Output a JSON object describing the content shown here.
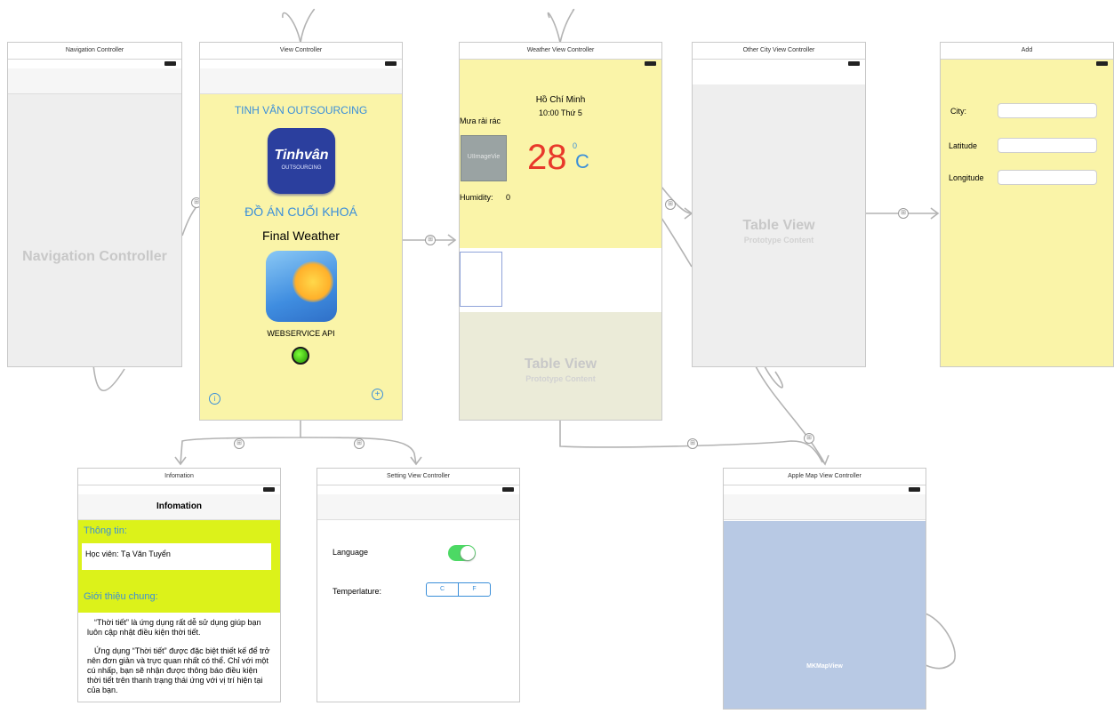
{
  "scenes": {
    "navigation": {
      "title": "Navigation Controller",
      "label": "Navigation Controller"
    },
    "view": {
      "title": "View Controller",
      "heading": "TINH VÂN OUTSOURCING",
      "logo_text": "Tinhvân",
      "logo_sub": "OUTSOURCING",
      "project": "ĐỒ ÁN CUỐI KHOÁ",
      "app_name": "Final Weather",
      "api": "WEBSERVICE API",
      "info_icon": "info-icon",
      "add_icon": "plus-circle-icon"
    },
    "weather": {
      "title": "Weather View Controller",
      "city": "Hồ Chí Minh",
      "time": "10:00 Thứ 5",
      "condition": "Mưa rải rác",
      "image_placeholder": "UIImageVie",
      "temperature": "28",
      "degree": "0",
      "unit": "C",
      "humidity_label": "Humidity:",
      "humidity_value": "0",
      "table_title": "Table View",
      "table_sub": "Prototype Content"
    },
    "other_city": {
      "title": "Other City View Controller",
      "table_title": "Table View",
      "table_sub": "Prototype Content"
    },
    "add": {
      "title": "Add",
      "city_label": "City:",
      "lat_label": "Latitude",
      "lon_label": "Longitude"
    },
    "information": {
      "title": "Infomation",
      "nav_title": "Infomation",
      "info_heading": "Thông tin:",
      "student": "Học viên: Tạ Văn Tuyển",
      "intro_heading": "Giới thiệu chung:",
      "para1": "“Thời tiết” là ứng dụng rất dễ sử dụng giúp bạn luôn cập nhật điều kiện thời tiết.",
      "para2": "Ứng dụng “Thời tiết” được đặc biệt thiết kế để trở nên đơn giản và trực quan nhất có thể. Chỉ với một cú nhấp, bạn sẽ nhận được thông báo điều kiện thời tiết trên thanh trạng thái ứng với vị trí hiện tại của bạn."
    },
    "setting": {
      "title": "Setting View Controller",
      "language_label": "Language",
      "temperature_label": "Temperlature:",
      "opt_c": "C",
      "opt_f": "F",
      "language_toggle_on": true
    },
    "map": {
      "title": "Apple Map View Controller",
      "map_label": "MKMapView"
    }
  },
  "colors": {
    "canvas_yellow": "#faf4a8",
    "blue_text": "#3b8fd9",
    "red_temp": "#e8392b",
    "lime": "#dcf21a",
    "map_blue": "#b8c9e4",
    "toggle_green": "#4cd964"
  }
}
